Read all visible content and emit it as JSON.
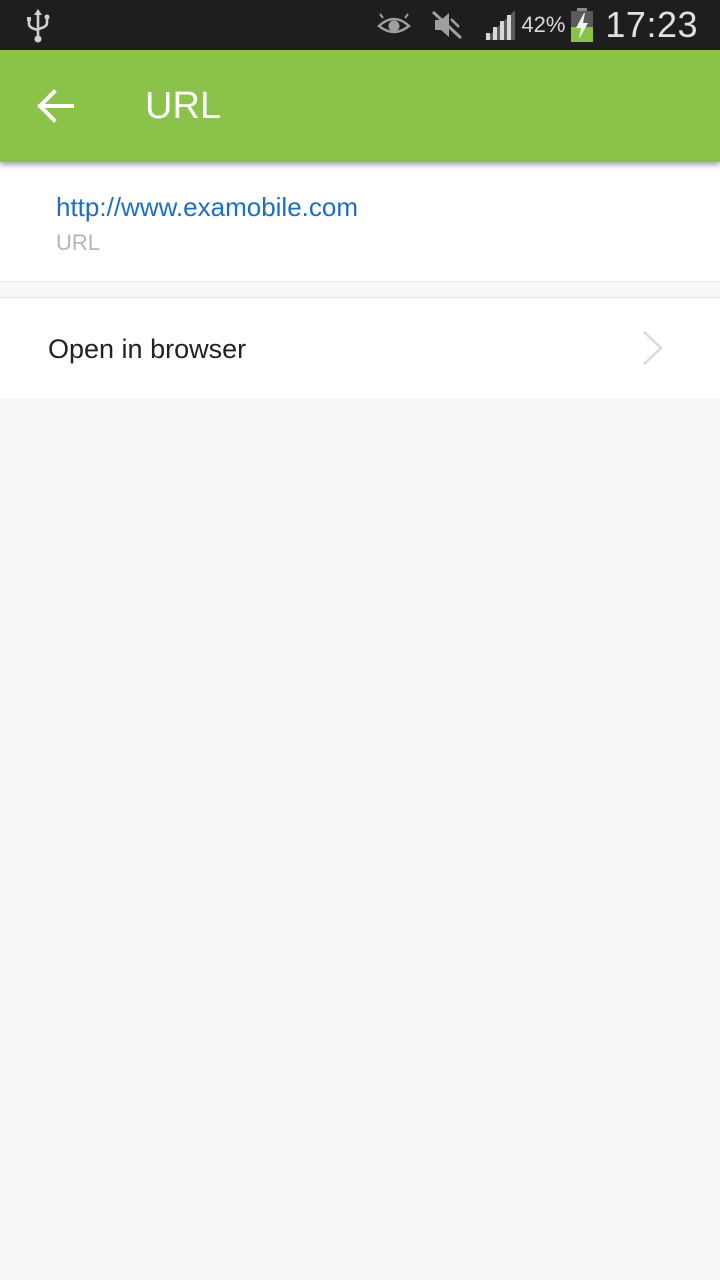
{
  "status_bar": {
    "battery_percent": "42%",
    "time": "17:23",
    "icons": [
      "usb-icon",
      "eye-icon",
      "mute-icon",
      "signal-icon",
      "battery-charging-icon"
    ]
  },
  "app_bar": {
    "title": "URL",
    "color": "#8bc34a"
  },
  "url_card": {
    "value": "http://www.examobile.com",
    "label": "URL",
    "link_color": "#1e6fc2"
  },
  "actions": {
    "open_in_browser": "Open in browser"
  }
}
